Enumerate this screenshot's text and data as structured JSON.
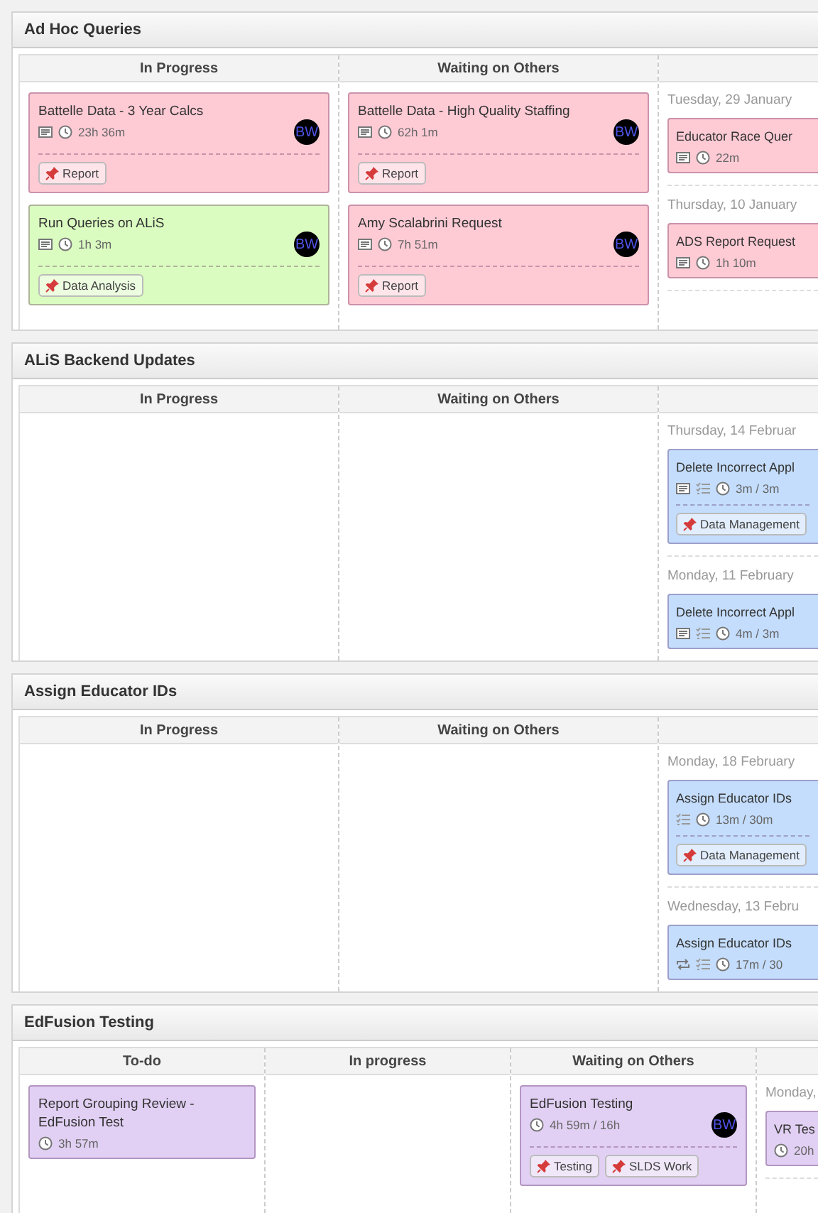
{
  "boards": [
    {
      "title": "Ad Hoc Queries",
      "columns": [
        {
          "heading": "In Progress",
          "kind": "cards",
          "cards": [
            {
              "title": "Battelle Data - 3 Year Calcs",
              "color": "#fecbd5",
              "notes": true,
              "checklist": false,
              "recurring": false,
              "time": "23h 36m",
              "assignee": "BW",
              "tags": [
                "Report"
              ]
            },
            {
              "title": "Run Queries on ALiS",
              "color": "#dafcc0",
              "notes": true,
              "checklist": false,
              "recurring": false,
              "time": "1h 3m",
              "assignee": "BW",
              "tags": [
                "Data Analysis"
              ]
            }
          ]
        },
        {
          "heading": "Waiting on Others",
          "kind": "cards",
          "cards": [
            {
              "title": "Battelle Data - High Quality Staffing",
              "color": "#fecbd5",
              "notes": true,
              "checklist": false,
              "recurring": false,
              "time": "62h 1m",
              "assignee": "BW",
              "tags": [
                "Report"
              ]
            },
            {
              "title": "Amy Scalabrini Request",
              "color": "#fecbd5",
              "notes": true,
              "checklist": false,
              "recurring": false,
              "time": "7h 51m",
              "assignee": "BW",
              "tags": [
                "Report"
              ]
            }
          ]
        },
        {
          "kind": "dated",
          "groups": [
            {
              "date": "Tuesday, 29 January",
              "cards": [
                {
                  "title": "Educator Race Quer",
                  "color": "#fecbd5",
                  "notes": true,
                  "checklist": false,
                  "recurring": false,
                  "time": "22m"
                }
              ]
            },
            {
              "date": "Thursday, 10 January",
              "cards": [
                {
                  "title": "ADS Report Request",
                  "color": "#fecbd5",
                  "notes": true,
                  "checklist": false,
                  "recurring": false,
                  "time": "1h 10m"
                }
              ]
            }
          ]
        }
      ]
    },
    {
      "title": "ALiS Backend Updates",
      "columns": [
        {
          "heading": "In Progress",
          "kind": "cards"
        },
        {
          "heading": "Waiting on Others",
          "kind": "cards"
        },
        {
          "kind": "dated",
          "groups": [
            {
              "date": "Thursday, 14 Februar",
              "cards": [
                {
                  "title": "Delete Incorrect Appl",
                  "color": "#c4ddfc",
                  "notes": true,
                  "checklist": true,
                  "recurring": false,
                  "time": "3m / 3m",
                  "tags": [
                    "Data Management"
                  ]
                }
              ]
            },
            {
              "date": "Monday, 11 February",
              "cards": [
                {
                  "title": "Delete Incorrect Appl",
                  "color": "#c4ddfc",
                  "notes": true,
                  "checklist": true,
                  "recurring": false,
                  "time": "4m / 3m"
                }
              ]
            }
          ]
        }
      ]
    },
    {
      "title": "Assign Educator IDs",
      "columns": [
        {
          "heading": "In Progress",
          "kind": "cards"
        },
        {
          "heading": "Waiting on Others",
          "kind": "cards"
        },
        {
          "kind": "dated",
          "groups": [
            {
              "date": "Monday, 18 February",
              "cards": [
                {
                  "title": "Assign Educator IDs",
                  "color": "#c4ddfc",
                  "notes": false,
                  "checklist": true,
                  "recurring": false,
                  "time": "13m / 30m",
                  "tags": [
                    "Data Management"
                  ]
                }
              ]
            },
            {
              "date": "Wednesday, 13 Febru",
              "cards": [
                {
                  "title": "Assign Educator IDs",
                  "color": "#c4ddfc",
                  "notes": false,
                  "checklist": true,
                  "recurring": true,
                  "time": "17m / 30"
                }
              ]
            }
          ]
        }
      ]
    },
    {
      "title": "EdFusion Testing",
      "columns": [
        {
          "heading": "To-do",
          "kind": "cards",
          "cards": [
            {
              "title": "Report Grouping Review - EdFusion Test",
              "color": "#e1d0f3",
              "notes": false,
              "checklist": false,
              "recurring": false,
              "time": "3h 57m"
            }
          ]
        },
        {
          "heading": "In progress",
          "kind": "cards"
        },
        {
          "heading": "Waiting on Others",
          "kind": "cards",
          "cards": [
            {
              "title": "EdFusion Testing",
              "color": "#e1d0f3",
              "notes": false,
              "checklist": false,
              "recurring": false,
              "time": "4h 59m / 16h",
              "assignee": "BW",
              "tags": [
                "Testing",
                "SLDS Work"
              ]
            }
          ]
        },
        {
          "kind": "dated",
          "groups": [
            {
              "date": "Monday,",
              "cards": [
                {
                  "title": "VR Tes",
                  "color": "#e1d0f3",
                  "notes": false,
                  "checklist": false,
                  "recurring": false,
                  "time": "20h"
                }
              ]
            }
          ]
        }
      ]
    }
  ]
}
